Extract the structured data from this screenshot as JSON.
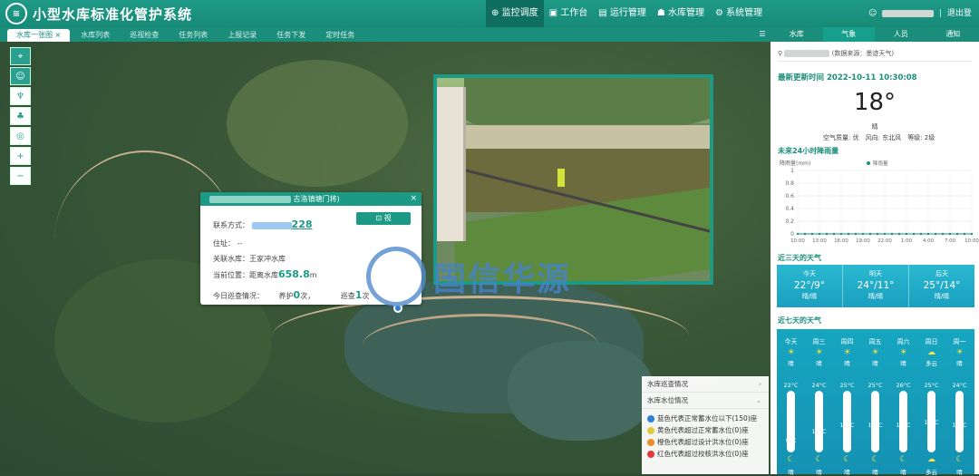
{
  "header": {
    "logo_icon": "dam-logo-icon",
    "title": "小型水库标准化管护系统",
    "nav": [
      {
        "label": "监控调度",
        "icon": "monitor-icon",
        "active": true
      },
      {
        "label": "工作台",
        "icon": "desk-icon"
      },
      {
        "label": "运行管理",
        "icon": "chart-icon"
      },
      {
        "label": "水库管理",
        "icon": "people-icon"
      },
      {
        "label": "系统管理",
        "icon": "gear-icon"
      }
    ],
    "logout": "退出登录"
  },
  "tabs": [
    {
      "label": "水库一张图",
      "active": true
    },
    {
      "label": "水库列表"
    },
    {
      "label": "巡视检查"
    },
    {
      "label": "任务列表"
    },
    {
      "label": "上报记录"
    },
    {
      "label": "任务下发"
    },
    {
      "label": "定时任务"
    }
  ],
  "right_tabs": [
    {
      "label": "水库"
    },
    {
      "label": "气象",
      "active": true
    },
    {
      "label": "人员"
    },
    {
      "label": "通知"
    }
  ],
  "map_tools": [
    {
      "icon": "location-icon",
      "sel": true
    },
    {
      "icon": "person-icon",
      "sel": true
    },
    {
      "icon": "reservoir-icon"
    },
    {
      "icon": "tree-icon"
    },
    {
      "icon": "target-icon"
    },
    {
      "label": "+"
    },
    {
      "label": "−"
    }
  ],
  "popup": {
    "title_suffix": "古洛镇塘门将)",
    "contact_label": "联系方式：",
    "contact_suffix": "228",
    "address_label": "住址：",
    "address_value": "--",
    "reservoir_label": "关联水库：",
    "reservoir_value": "王家冲水库",
    "position_label": "当前位置：",
    "position_prefix": "距离水库",
    "position_distance": "658.8",
    "position_unit": "m",
    "today_label": "今日巡查情况：",
    "maint_label": "养护",
    "maint_count": "0",
    "maint_unit": "次，",
    "patrol_label": "巡查",
    "patrol_count": "1",
    "patrol_unit": "次",
    "video_button": "视"
  },
  "watermark": {
    "text": "国信华源"
  },
  "legend": {
    "patrol_header": "水库巡查情况",
    "level_header": "水库水位情况",
    "items": [
      {
        "text": "蓝色代表正常蓄水位以下(150)座",
        "color": "#2f7fd8"
      },
      {
        "text": "黄色代表超过正常蓄水位(0)座",
        "color": "#e6c93a"
      },
      {
        "text": "橙色代表超过设计洪水位(0)座",
        "color": "#ef8a2a"
      },
      {
        "text": "红色代表超过校核洪水位(0)座",
        "color": "#e03a3a"
      }
    ]
  },
  "weather": {
    "source": "(数据来源：墨迹天气)",
    "updated_label": "最新更新时间",
    "updated_value": "2022-10-11 10:30:08",
    "temp": "18°",
    "cond": "晴",
    "aqi_label": "空气质量:",
    "aqi": "优",
    "wind_label": "风向:",
    "wind": "东北风",
    "level_label": "等级:",
    "level": "2级",
    "rain_title": "未来24小时降雨量",
    "three_title": "近三天的天气",
    "seven_title": "近七天的天气",
    "three": [
      {
        "day": "今天",
        "temp": "22°/9°",
        "cond": "晴/晴"
      },
      {
        "day": "明天",
        "temp": "24°/11°",
        "cond": "晴/晴"
      },
      {
        "day": "后天",
        "temp": "25°/14°",
        "cond": "晴/晴"
      }
    ],
    "seven": [
      {
        "day": "今天",
        "hi": "22°C",
        "lo": "9°C",
        "w1": "晴",
        "w2": "晴"
      },
      {
        "day": "周三",
        "hi": "24°C",
        "lo": "11°C",
        "w1": "晴",
        "w2": "晴"
      },
      {
        "day": "周四",
        "hi": "25°C",
        "lo": "14°C",
        "w1": "晴",
        "w2": "晴"
      },
      {
        "day": "周五",
        "hi": "25°C",
        "lo": "14°C",
        "w1": "晴",
        "w2": "晴"
      },
      {
        "day": "周六",
        "hi": "26°C",
        "lo": "14°C",
        "w1": "晴",
        "w2": "晴"
      },
      {
        "day": "周日",
        "hi": "25°C",
        "lo": "15°C",
        "w1": "多云",
        "w2": "多云"
      },
      {
        "day": "周一",
        "hi": "24°C",
        "lo": "14°C",
        "w1": "晴",
        "w2": "晴"
      }
    ]
  },
  "chart_data": {
    "type": "line",
    "title": "",
    "ylabel": "降雨量(mm)",
    "legend": [
      "降雨量"
    ],
    "legend_position": "top-center",
    "ylim": [
      0,
      1
    ],
    "yticks": [
      "0",
      "0.2",
      "0.4",
      "0.6",
      "0.8",
      "1"
    ],
    "categories": [
      "10:00",
      "13:00",
      "16:00",
      "19:00",
      "22:00",
      "1:00",
      "4:00",
      "7:00",
      "10:00"
    ],
    "values": [
      0,
      0,
      0,
      0,
      0,
      0,
      0,
      0,
      0,
      0,
      0,
      0,
      0,
      0,
      0,
      0,
      0,
      0,
      0,
      0,
      0,
      0,
      0,
      0,
      0
    ],
    "grid": true,
    "color": "#1b8e7b"
  }
}
